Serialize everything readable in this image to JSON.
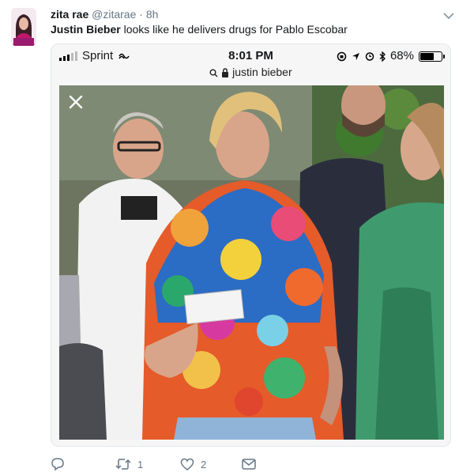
{
  "tweet": {
    "display_name": "zita rae",
    "handle": "@zitarae",
    "separator": "·",
    "time": "8h",
    "text_bold": "Justin Bieber",
    "text_rest": " looks like he delivers drugs for Pablo Escobar"
  },
  "screenshot": {
    "carrier": "Sprint",
    "clock": "8:01 PM",
    "battery_percent": "68%",
    "battery_level": 0.68,
    "url": "justin bieber"
  },
  "actions": {
    "retweet_count": "1",
    "like_count": "2"
  },
  "colors": {
    "text": "#14171a",
    "muted": "#657786",
    "border": "#e1e8ed"
  },
  "icons": [
    "reply-icon",
    "retweet-icon",
    "like-icon",
    "message-icon",
    "chevron-down-icon",
    "close-icon",
    "lock-icon",
    "search-icon"
  ]
}
